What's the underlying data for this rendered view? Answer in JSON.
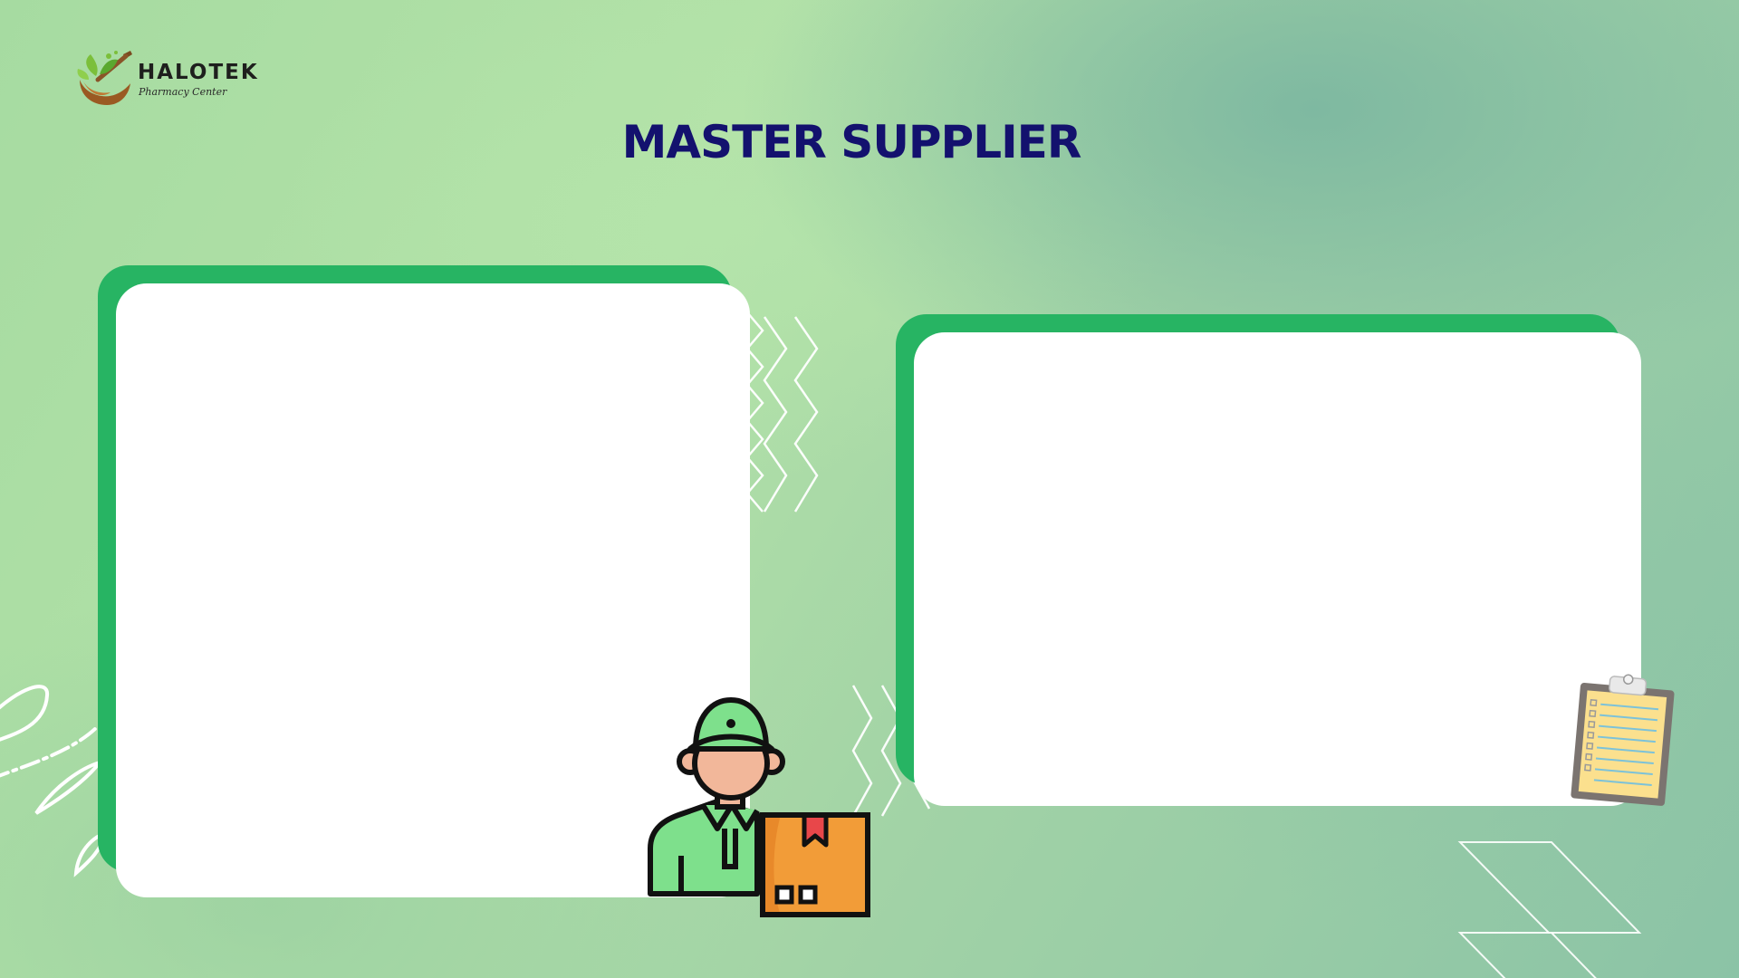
{
  "brand": {
    "name": "HALOTEK",
    "tagline": "Pharmacy Center",
    "logo_icon": "mortar-pestle-leaf-icon"
  },
  "page": {
    "title": "MASTER SUPPLIER"
  },
  "colors": {
    "title": "#13116e",
    "card_accent": "#27b463",
    "card_body": "#ffffff",
    "courier_shirt": "#7ee08c",
    "box": "#f29c38"
  },
  "illustrations": {
    "left": "courier-with-box-icon",
    "right": "clipboard-checklist-icon"
  }
}
